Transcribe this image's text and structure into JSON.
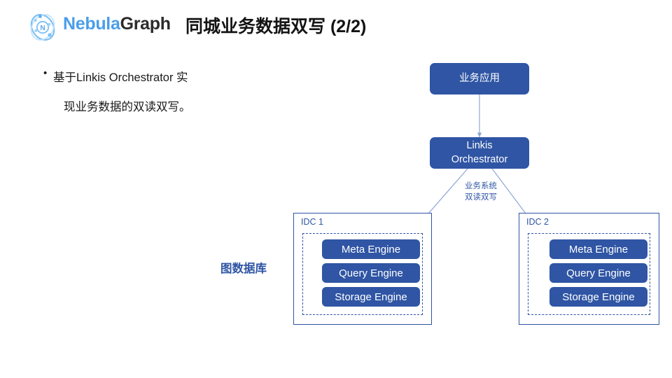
{
  "header": {
    "brand_nebula": "Nebula",
    "brand_graph": "Graph",
    "logo_icon": "nebula-orbit-logo",
    "logo_letter": "N",
    "title": "同城业务数据双写 (2/2)"
  },
  "body_text": {
    "bullet_marker": "•",
    "lines": [
      "基于Linkis Orchestrator 实",
      "现业务数据的双读双写。"
    ]
  },
  "diagram": {
    "nodes": {
      "business_app": "业务应用",
      "linkis_line1": "Linkis",
      "linkis_line2": "Orchestrator"
    },
    "edge_label_line1": "业务系统",
    "edge_label_line2": "双读双写",
    "graph_db_label": "图数据库",
    "idcs": [
      {
        "label": "IDC 1",
        "engines": [
          "Meta Engine",
          "Query Engine",
          "Storage Engine"
        ]
      },
      {
        "label": "IDC 2",
        "engines": [
          "Meta Engine",
          "Query Engine",
          "Storage Engine"
        ]
      }
    ]
  },
  "colors": {
    "brand_blue": "#4a9eea",
    "brand_dark": "#2b2b2b",
    "node_blue": "#2f55a4",
    "connector_blue": "#8fa6d4",
    "background": "#ffffff"
  }
}
